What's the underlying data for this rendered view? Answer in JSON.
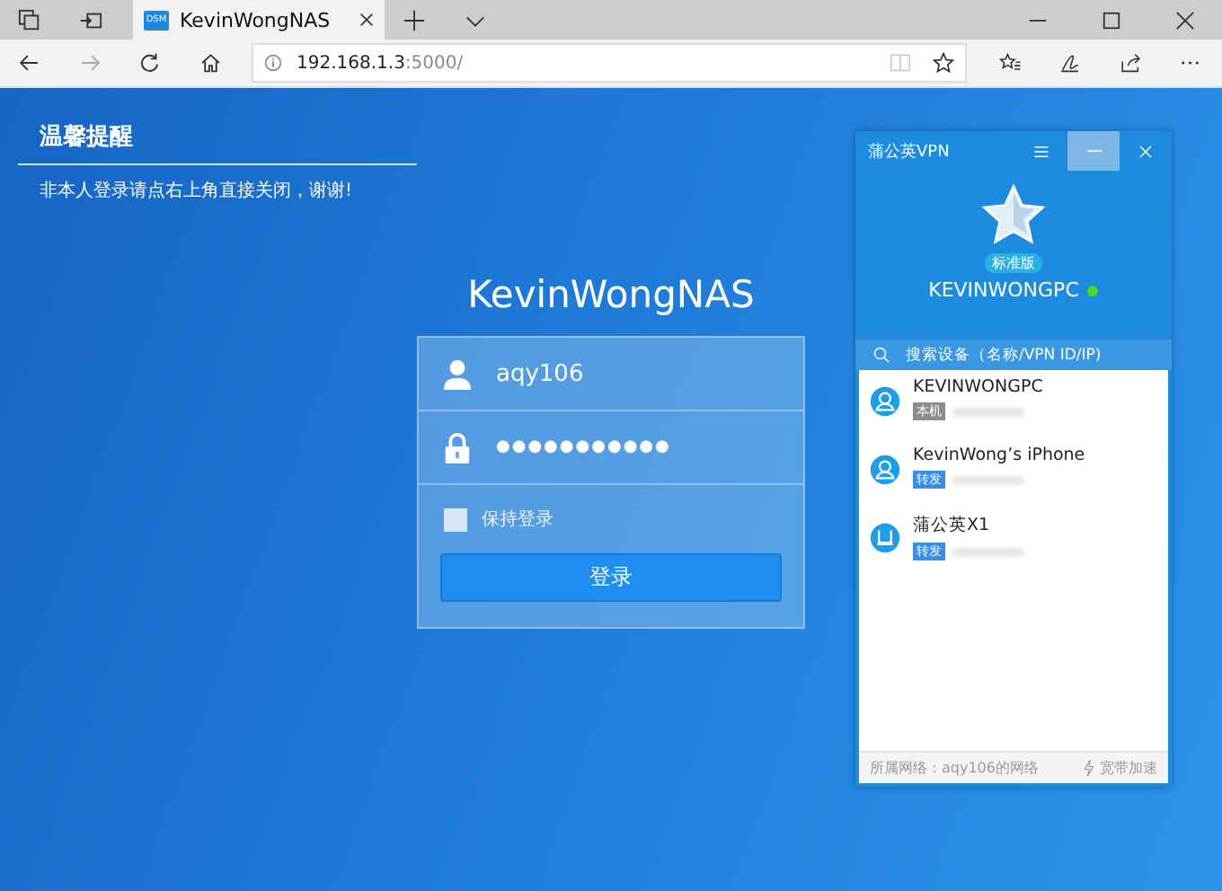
{
  "browser": {
    "tab": {
      "title": "KevinWongNAS",
      "favicon": "DSM",
      "selected": true
    },
    "url_host": "192.168.1.3",
    "url_rest": ":5000/"
  },
  "notice": {
    "title": "温馨提醒",
    "message": "非本人登录请点右上角直接关闭，谢谢!"
  },
  "login": {
    "title": "KevinWongNAS",
    "username": "aqy106",
    "password": "●●●●●●●●●●●",
    "remember": {
      "label": "保持登录",
      "checked": false
    },
    "submit": "登录"
  },
  "vpn": {
    "title": "蒲公英VPN",
    "edition": "标准版",
    "device_name": "KEVINWONGPC",
    "online": true,
    "search": {
      "placeholder": "搜索设备（名称/VPN ID/IP)"
    },
    "devices": [
      {
        "name": "KEVINWONGPC",
        "kind": "pc",
        "tag": "本机",
        "color": "#8c8c8c"
      },
      {
        "name": "KevinWong’s iPhone",
        "kind": "phone",
        "tag": "转发",
        "color": "#3a8ee6"
      },
      {
        "name": "蒲公英X1",
        "kind": "router",
        "tag": "转发",
        "color": "#3a8ee6"
      }
    ],
    "footer": {
      "network": "所属网络：aqy106的网络",
      "boost": "宽带加速"
    }
  }
}
